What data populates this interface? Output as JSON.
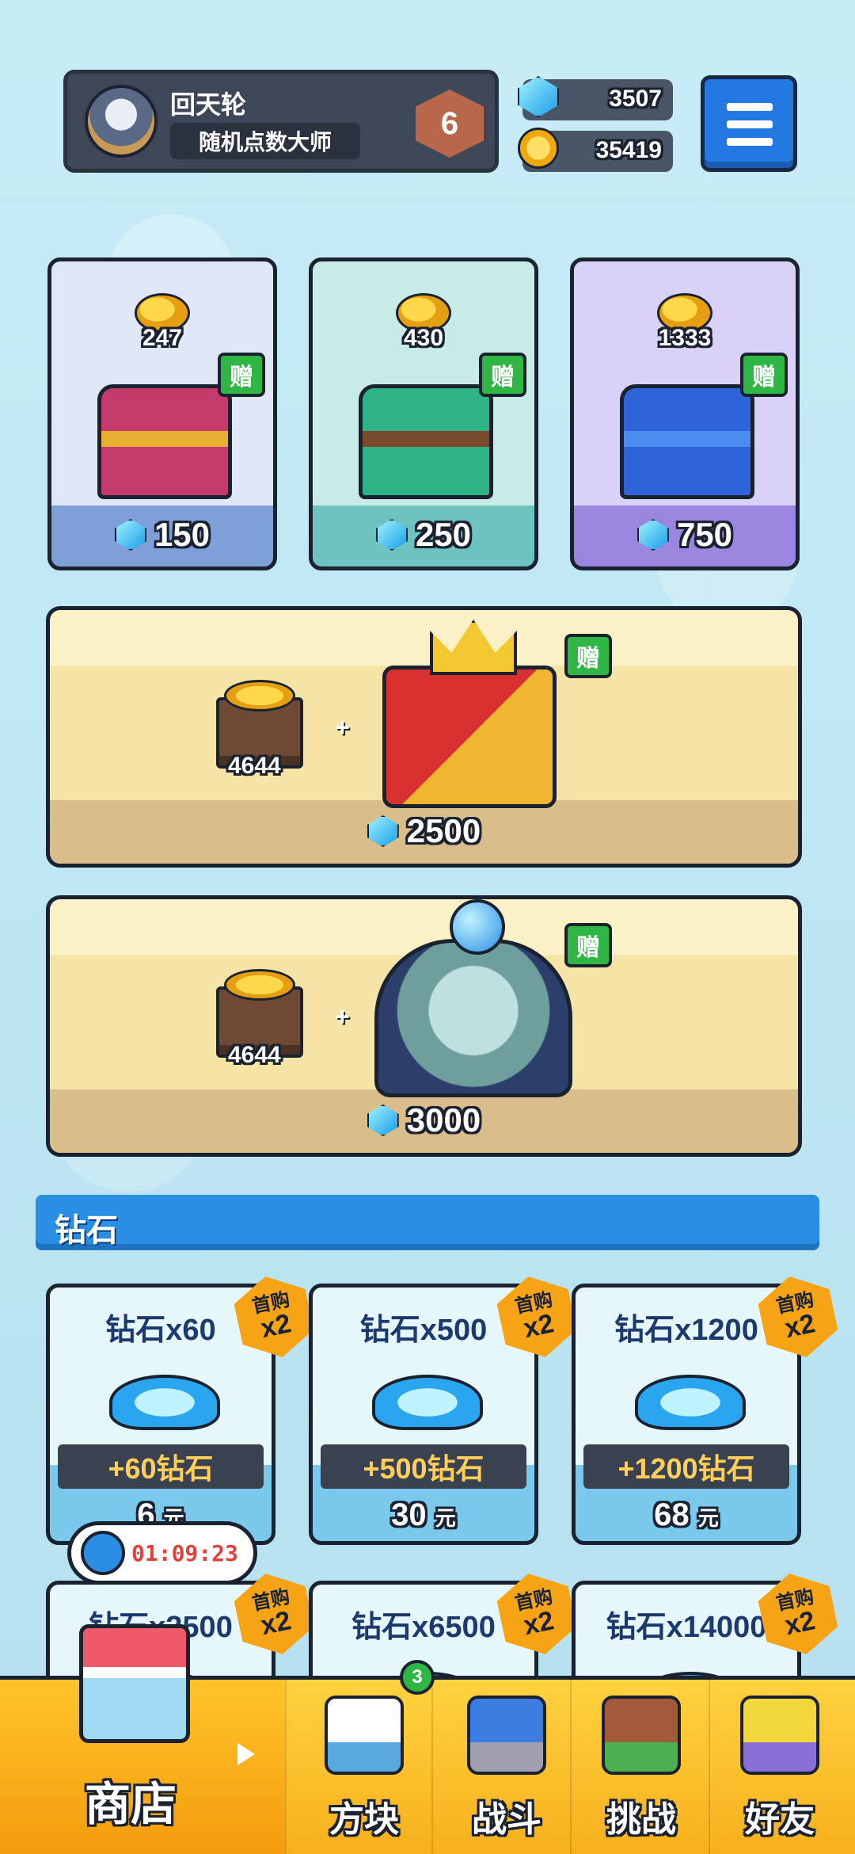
{
  "profile": {
    "name": "回天轮",
    "title": "随机点数大师",
    "rank": "6"
  },
  "currencies": {
    "gems": "3507",
    "coins": "35419"
  },
  "chests": [
    {
      "coins": "247",
      "price": "150",
      "gift_label": "赠"
    },
    {
      "coins": "430",
      "price": "250",
      "gift_label": "赠"
    },
    {
      "coins": "1333",
      "price": "750",
      "gift_label": "赠"
    }
  ],
  "bundles": [
    {
      "crate_amount": "4644",
      "plus": "+",
      "price": "2500",
      "gift_label": "赠"
    },
    {
      "crate_amount": "4644",
      "plus": "+",
      "price": "3000",
      "gift_label": "赠"
    }
  ],
  "diamond_section": {
    "title": "钻石",
    "first_buy": "首购",
    "x2": "x2",
    "items": [
      {
        "name": "钻石x60",
        "bonus": "+60钻石",
        "price": "6",
        "unit": "元"
      },
      {
        "name": "钻石x500",
        "bonus": "+500钻石",
        "price": "30",
        "unit": "元"
      },
      {
        "name": "钻石x1200",
        "bonus": "+1200钻石",
        "price": "68",
        "unit": "元"
      },
      {
        "name": "钻石x2500"
      },
      {
        "name": "钻石x6500"
      },
      {
        "name": "钻石x14000"
      }
    ]
  },
  "timer": "01:09:23",
  "nav": {
    "shop": "商店",
    "blocks": "方块",
    "blocks_badge": "3",
    "battle": "战斗",
    "challenge": "挑战",
    "friends": "好友"
  },
  "colors": {
    "accent_blue": "#2a8fe4",
    "gift_green": "#2fb644",
    "nav_yellow": "#ffd23f"
  }
}
